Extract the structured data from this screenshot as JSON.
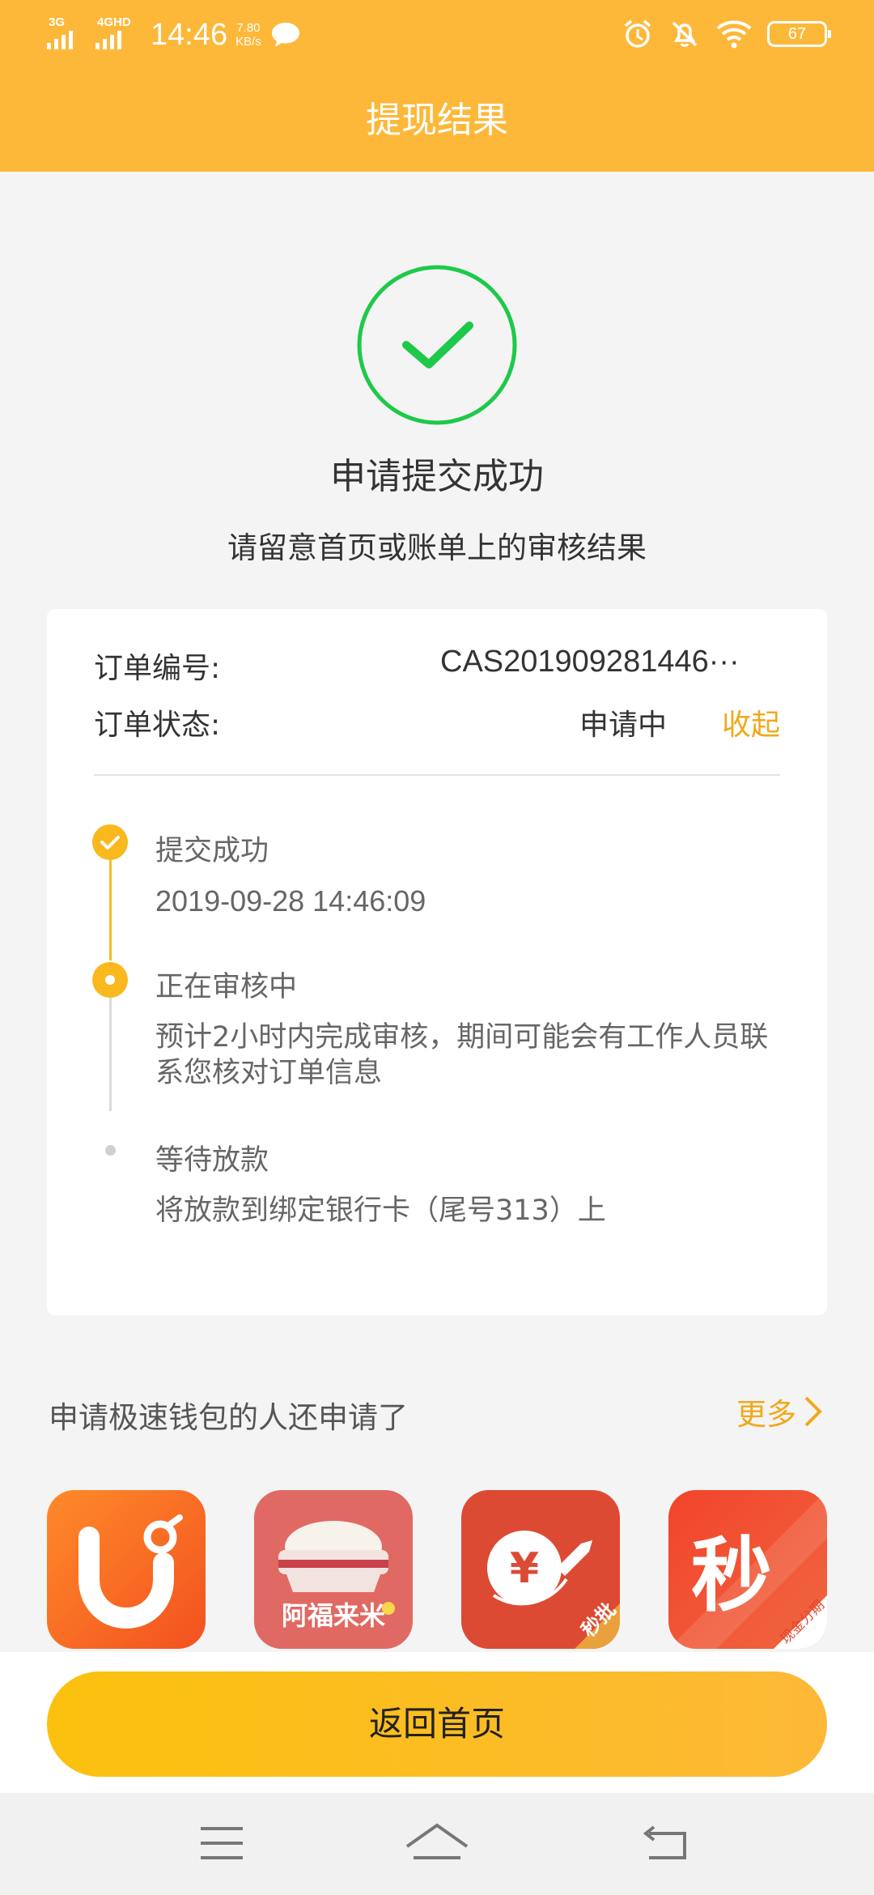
{
  "status_bar": {
    "network1": "3G",
    "network2": "4GHD",
    "time": "14:46",
    "speed_value": "7.80",
    "speed_unit": "KB/s",
    "battery": "67"
  },
  "header": {
    "title": "提现结果"
  },
  "result": {
    "title": "申请提交成功",
    "subtitle": "请留意首页或账单上的审核结果"
  },
  "order": {
    "number_label": "订单编号:",
    "number_value": "CAS201909281446···",
    "status_label": "订单状态:",
    "status_value": "申请中",
    "collapse_label": "收起"
  },
  "timeline": [
    {
      "title": "提交成功",
      "detail": "2019-09-28 14:46:09",
      "state": "done"
    },
    {
      "title": "正在审核中",
      "detail": "预计2小时内完成审核，期间可能会有工作人员联系您核对订单信息",
      "state": "current"
    },
    {
      "title": "等待放款",
      "detail": "将放款到绑定银行卡（尾号313）上",
      "state": "pending"
    }
  ],
  "recommend": {
    "title": "申请极速钱包的人还申请了",
    "more_label": "更多",
    "apps": [
      {
        "icon": "u-loan-app-icon",
        "text": ""
      },
      {
        "icon": "rice-app-icon",
        "text": "阿福来米"
      },
      {
        "icon": "yuan-rocket-app-icon",
        "text": "秒批"
      },
      {
        "icon": "miao-app-icon",
        "text": "秒",
        "badge": "现金分期"
      }
    ]
  },
  "actions": {
    "home_button": "返回首页"
  },
  "colors": {
    "brand": "#fdb83a",
    "accent": "#f0a91b",
    "success": "#1ec94a"
  }
}
